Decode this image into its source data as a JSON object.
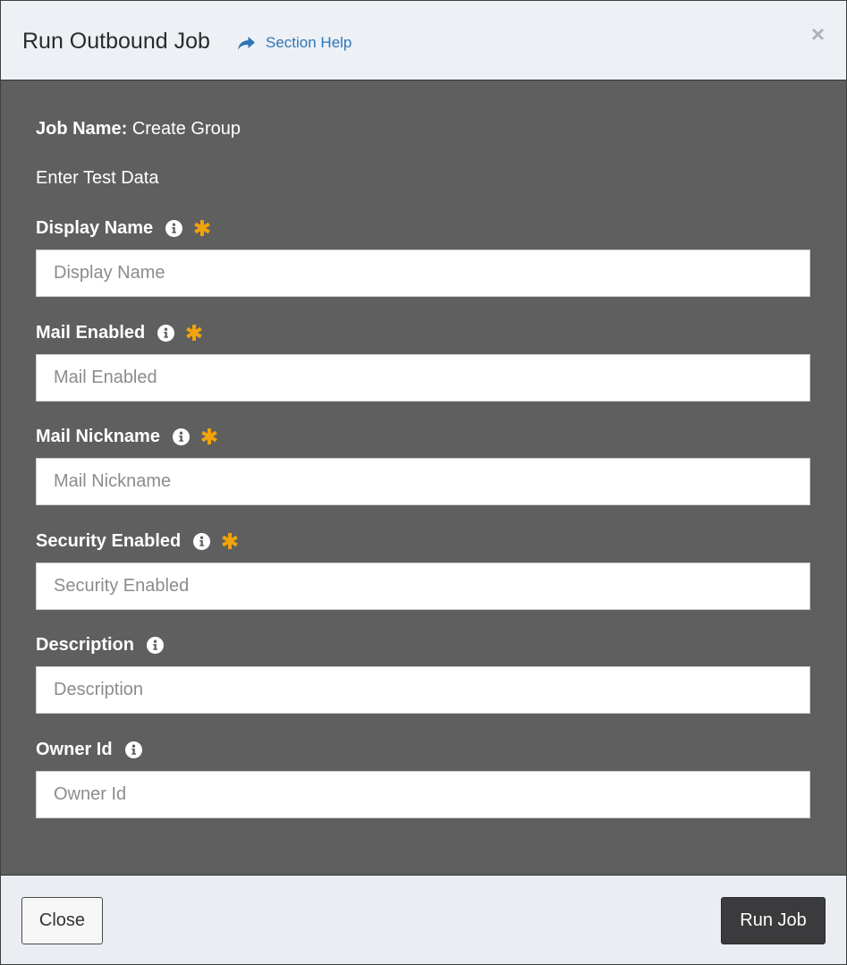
{
  "header": {
    "title": "Run Outbound Job",
    "help_label": "Section Help",
    "close_glyph": "×"
  },
  "body": {
    "job_name_label": "Job Name:",
    "job_name_value": "Create Group",
    "subheading": "Enter Test Data"
  },
  "fields": [
    {
      "label": "Display Name",
      "placeholder": "Display Name",
      "value": "",
      "required": true
    },
    {
      "label": "Mail Enabled",
      "placeholder": "Mail Enabled",
      "value": "",
      "required": true
    },
    {
      "label": "Mail Nickname",
      "placeholder": "Mail Nickname",
      "value": "",
      "required": true
    },
    {
      "label": "Security Enabled",
      "placeholder": "Security Enabled",
      "value": "",
      "required": true
    },
    {
      "label": "Description",
      "placeholder": "Description",
      "value": "",
      "required": false
    },
    {
      "label": "Owner Id",
      "placeholder": "Owner Id",
      "value": "",
      "required": false
    }
  ],
  "footer": {
    "close_label": "Close",
    "run_label": "Run Job"
  },
  "icons": {
    "help": "share-arrow-icon",
    "info": "info-circle-icon",
    "required": "asterisk-icon",
    "close": "close-icon"
  },
  "colors": {
    "link": "#2f75b8",
    "required": "#f0a30a",
    "body_bg": "#5f5f5f",
    "primary_button": "#3b3b3d"
  }
}
